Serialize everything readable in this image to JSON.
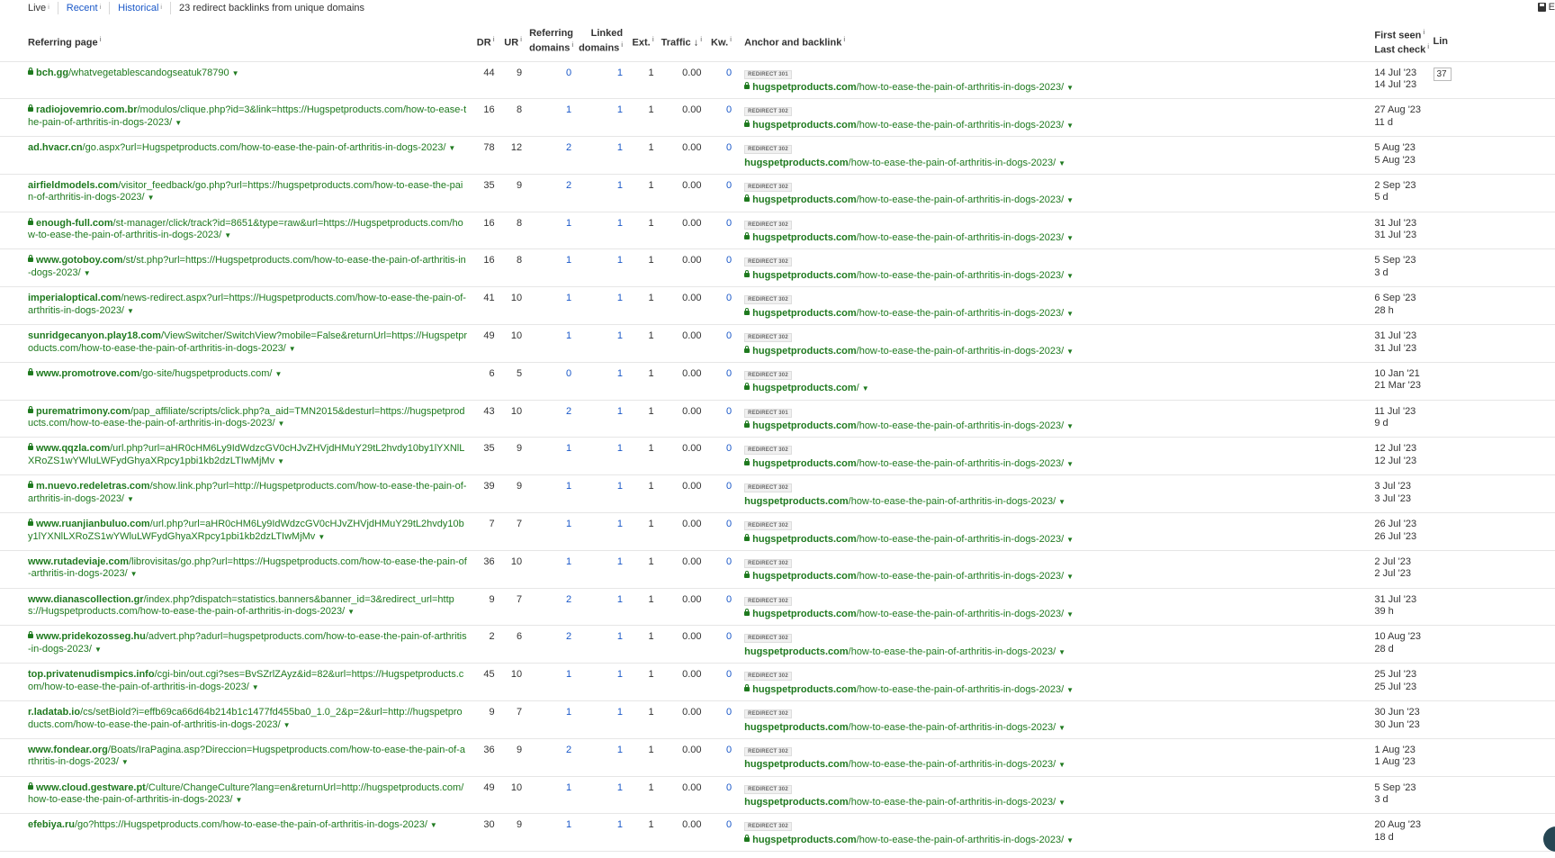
{
  "topbar": {
    "tabs": [
      "Live",
      "Recent",
      "Historical"
    ],
    "summary": "23 redirect backlinks from unique domains",
    "export_label": "E"
  },
  "columns": {
    "referring_page": "Referring page",
    "dr": "DR",
    "ur": "UR",
    "referring_domains_1": "Referring",
    "referring_domains_2": "domains",
    "linked_domains_1": "Linked",
    "linked_domains_2": "domains",
    "ext": "Ext.",
    "traffic": "Traffic",
    "traffic_sort": "↓",
    "kw": "Kw.",
    "anchor": "Anchor and backlink",
    "first_seen": "First seen",
    "last_check": "Last check",
    "lin": "Lin"
  },
  "rows": [
    {
      "secure": true,
      "domain": "bch.gg",
      "path": "/whatvegetablescandogseatuk78790",
      "dr": "44",
      "ur": "9",
      "rd": "0",
      "ld": "1",
      "ext": "1",
      "traffic": "0.00",
      "kw": "0",
      "redirect": "REDIRECT 301",
      "target_secure": true,
      "target_domain": "hugspetproducts.com",
      "target_path": "/how-to-ease-the-pain-of-arthritis-in-dogs-2023/",
      "first_seen": "14 Jul '23",
      "last_check": "14 Jul '23",
      "lin": "37"
    },
    {
      "secure": true,
      "domain": "radiojovemrio.com.br",
      "path": "/modulos/clique.php?id=3&link=https://Hugspetproducts.com/how-to-ease-the-pain-of-arthritis-in-dogs-2023/",
      "dr": "16",
      "ur": "8",
      "rd": "1",
      "ld": "1",
      "ext": "1",
      "traffic": "0.00",
      "kw": "0",
      "redirect": "REDIRECT 302",
      "target_secure": true,
      "target_domain": "hugspetproducts.com",
      "target_path": "/how-to-ease-the-pain-of-arthritis-in-dogs-2023/",
      "first_seen": "27 Aug '23",
      "last_check": "11 d"
    },
    {
      "secure": false,
      "domain": "ad.hvacr.cn",
      "path": "/go.aspx?url=Hugspetproducts.com/how-to-ease-the-pain-of-arthritis-in-dogs-2023/",
      "dr": "78",
      "ur": "12",
      "rd": "2",
      "ld": "1",
      "ext": "1",
      "traffic": "0.00",
      "kw": "0",
      "redirect": "REDIRECT 302",
      "target_secure": false,
      "target_domain": "hugspetproducts.com",
      "target_path": "/how-to-ease-the-pain-of-arthritis-in-dogs-2023/",
      "first_seen": "5 Aug '23",
      "last_check": "5 Aug '23"
    },
    {
      "secure": false,
      "domain": "airfieldmodels.com",
      "path": "/visitor_feedback/go.php?url=https://hugspetproducts.com/how-to-ease-the-pain-of-arthritis-in-dogs-2023/",
      "dr": "35",
      "ur": "9",
      "rd": "2",
      "ld": "1",
      "ext": "1",
      "traffic": "0.00",
      "kw": "0",
      "redirect": "REDIRECT 302",
      "target_secure": true,
      "target_domain": "hugspetproducts.com",
      "target_path": "/how-to-ease-the-pain-of-arthritis-in-dogs-2023/",
      "first_seen": "2 Sep '23",
      "last_check": "5 d"
    },
    {
      "secure": true,
      "domain": "enough-full.com",
      "path": "/st-manager/click/track?id=8651&type=raw&url=https://Hugspetproducts.com/how-to-ease-the-pain-of-arthritis-in-dogs-2023/",
      "dr": "16",
      "ur": "8",
      "rd": "1",
      "ld": "1",
      "ext": "1",
      "traffic": "0.00",
      "kw": "0",
      "redirect": "REDIRECT 302",
      "target_secure": true,
      "target_domain": "hugspetproducts.com",
      "target_path": "/how-to-ease-the-pain-of-arthritis-in-dogs-2023/",
      "first_seen": "31 Jul '23",
      "last_check": "31 Jul '23"
    },
    {
      "secure": true,
      "domain": "www.gotoboy.com",
      "path": "/st/st.php?url=https://Hugspetproducts.com/how-to-ease-the-pain-of-arthritis-in-dogs-2023/",
      "dr": "16",
      "ur": "8",
      "rd": "1",
      "ld": "1",
      "ext": "1",
      "traffic": "0.00",
      "kw": "0",
      "redirect": "REDIRECT 302",
      "target_secure": true,
      "target_domain": "hugspetproducts.com",
      "target_path": "/how-to-ease-the-pain-of-arthritis-in-dogs-2023/",
      "first_seen": "5 Sep '23",
      "last_check": "3 d"
    },
    {
      "secure": false,
      "domain": "imperialoptical.com",
      "path": "/news-redirect.aspx?url=https://Hugspetproducts.com/how-to-ease-the-pain-of-arthritis-in-dogs-2023/",
      "dr": "41",
      "ur": "10",
      "rd": "1",
      "ld": "1",
      "ext": "1",
      "traffic": "0.00",
      "kw": "0",
      "redirect": "REDIRECT 302",
      "target_secure": true,
      "target_domain": "hugspetproducts.com",
      "target_path": "/how-to-ease-the-pain-of-arthritis-in-dogs-2023/",
      "first_seen": "6 Sep '23",
      "last_check": "28 h"
    },
    {
      "secure": false,
      "domain": "sunridgecanyon.play18.com",
      "path": "/ViewSwitcher/SwitchView?mobile=False&returnUrl=https://Hugspetproducts.com/how-to-ease-the-pain-of-arthritis-in-dogs-2023/",
      "dr": "49",
      "ur": "10",
      "rd": "1",
      "ld": "1",
      "ext": "1",
      "traffic": "0.00",
      "kw": "0",
      "redirect": "REDIRECT 302",
      "target_secure": true,
      "target_domain": "hugspetproducts.com",
      "target_path": "/how-to-ease-the-pain-of-arthritis-in-dogs-2023/",
      "first_seen": "31 Jul '23",
      "last_check": "31 Jul '23"
    },
    {
      "secure": true,
      "domain": "www.promotrove.com",
      "path": "/go-site/hugspetproducts.com/",
      "dr": "6",
      "ur": "5",
      "rd": "0",
      "ld": "1",
      "ext": "1",
      "traffic": "0.00",
      "kw": "0",
      "redirect": "REDIRECT 302",
      "target_secure": true,
      "target_domain": "hugspetproducts.com",
      "target_path": "/",
      "first_seen": "10 Jan '21",
      "last_check": "21 Mar '23"
    },
    {
      "secure": true,
      "domain": "purematrimony.com",
      "path": "/pap_affiliate/scripts/click.php?a_aid=TMN2015&desturl=https://hugspetproducts.com/how-to-ease-the-pain-of-arthritis-in-dogs-2023/",
      "dr": "43",
      "ur": "10",
      "rd": "2",
      "ld": "1",
      "ext": "1",
      "traffic": "0.00",
      "kw": "0",
      "redirect": "REDIRECT 301",
      "target_secure": true,
      "target_domain": "hugspetproducts.com",
      "target_path": "/how-to-ease-the-pain-of-arthritis-in-dogs-2023/",
      "first_seen": "11 Jul '23",
      "last_check": "9 d"
    },
    {
      "secure": true,
      "domain": "www.qqzla.com",
      "path": "/url.php?url=aHR0cHM6Ly9IdWdzcGV0cHJvZHVjdHMuY29tL2hvdy10by1lYXNlLXRoZS1wYWluLWFydGhyaXRpcy1pbi1kb2dzLTIwMjMv",
      "dr": "35",
      "ur": "9",
      "rd": "1",
      "ld": "1",
      "ext": "1",
      "traffic": "0.00",
      "kw": "0",
      "redirect": "REDIRECT 302",
      "target_secure": true,
      "target_domain": "hugspetproducts.com",
      "target_path": "/how-to-ease-the-pain-of-arthritis-in-dogs-2023/",
      "first_seen": "12 Jul '23",
      "last_check": "12 Jul '23"
    },
    {
      "secure": true,
      "domain": "m.nuevo.redeletras.com",
      "path": "/show.link.php?url=http://Hugspetproducts.com/how-to-ease-the-pain-of-arthritis-in-dogs-2023/",
      "dr": "39",
      "ur": "9",
      "rd": "1",
      "ld": "1",
      "ext": "1",
      "traffic": "0.00",
      "kw": "0",
      "redirect": "REDIRECT 302",
      "target_secure": false,
      "target_domain": "hugspetproducts.com",
      "target_path": "/how-to-ease-the-pain-of-arthritis-in-dogs-2023/",
      "first_seen": "3 Jul '23",
      "last_check": "3 Jul '23"
    },
    {
      "secure": true,
      "domain": "www.ruanjianbuluo.com",
      "path": "/url.php?url=aHR0cHM6Ly9IdWdzcGV0cHJvZHVjdHMuY29tL2hvdy10by1lYXNlLXRoZS1wYWluLWFydGhyaXRpcy1pbi1kb2dzLTIwMjMv",
      "dr": "7",
      "ur": "7",
      "rd": "1",
      "ld": "1",
      "ext": "1",
      "traffic": "0.00",
      "kw": "0",
      "redirect": "REDIRECT 302",
      "target_secure": true,
      "target_domain": "hugspetproducts.com",
      "target_path": "/how-to-ease-the-pain-of-arthritis-in-dogs-2023/",
      "first_seen": "26 Jul '23",
      "last_check": "26 Jul '23"
    },
    {
      "secure": false,
      "domain": "www.rutadeviaje.com",
      "path": "/librovisitas/go.php?url=https://Hugspetproducts.com/how-to-ease-the-pain-of-arthritis-in-dogs-2023/",
      "dr": "36",
      "ur": "10",
      "rd": "1",
      "ld": "1",
      "ext": "1",
      "traffic": "0.00",
      "kw": "0",
      "redirect": "REDIRECT 302",
      "target_secure": true,
      "target_domain": "hugspetproducts.com",
      "target_path": "/how-to-ease-the-pain-of-arthritis-in-dogs-2023/",
      "first_seen": "2 Jul '23",
      "last_check": "2 Jul '23"
    },
    {
      "secure": false,
      "domain": "www.dianascollection.gr",
      "path": "/index.php?dispatch=statistics.banners&banner_id=3&redirect_url=https://Hugspetproducts.com/how-to-ease-the-pain-of-arthritis-in-dogs-2023/",
      "dr": "9",
      "ur": "7",
      "rd": "2",
      "ld": "1",
      "ext": "1",
      "traffic": "0.00",
      "kw": "0",
      "redirect": "REDIRECT 302",
      "target_secure": true,
      "target_domain": "hugspetproducts.com",
      "target_path": "/how-to-ease-the-pain-of-arthritis-in-dogs-2023/",
      "first_seen": "31 Jul '23",
      "last_check": "39 h"
    },
    {
      "secure": true,
      "domain": "www.pridekozosseg.hu",
      "path": "/advert.php?adurl=hugspetproducts.com/how-to-ease-the-pain-of-arthritis-in-dogs-2023/",
      "dr": "2",
      "ur": "6",
      "rd": "2",
      "ld": "1",
      "ext": "1",
      "traffic": "0.00",
      "kw": "0",
      "redirect": "REDIRECT 302",
      "target_secure": false,
      "target_domain": "hugspetproducts.com",
      "target_path": "/how-to-ease-the-pain-of-arthritis-in-dogs-2023/",
      "first_seen": "10 Aug '23",
      "last_check": "28 d"
    },
    {
      "secure": false,
      "domain": "top.privatenudismpics.info",
      "path": "/cgi-bin/out.cgi?ses=BvSZrlZAyz&id=82&url=https://Hugspetproducts.com/how-to-ease-the-pain-of-arthritis-in-dogs-2023/",
      "dr": "45",
      "ur": "10",
      "rd": "1",
      "ld": "1",
      "ext": "1",
      "traffic": "0.00",
      "kw": "0",
      "redirect": "REDIRECT 302",
      "target_secure": true,
      "target_domain": "hugspetproducts.com",
      "target_path": "/how-to-ease-the-pain-of-arthritis-in-dogs-2023/",
      "first_seen": "25 Jul '23",
      "last_check": "25 Jul '23"
    },
    {
      "secure": false,
      "domain": "r.ladatab.io",
      "path": "/cs/setBiold?i=effb69ca66d64b214b1c1477fd455ba0_1.0_2&p=2&url=http://hugspetproducts.com/how-to-ease-the-pain-of-arthritis-in-dogs-2023/",
      "dr": "9",
      "ur": "7",
      "rd": "1",
      "ld": "1",
      "ext": "1",
      "traffic": "0.00",
      "kw": "0",
      "redirect": "REDIRECT 302",
      "target_secure": false,
      "target_domain": "hugspetproducts.com",
      "target_path": "/how-to-ease-the-pain-of-arthritis-in-dogs-2023/",
      "first_seen": "30 Jun '23",
      "last_check": "30 Jun '23"
    },
    {
      "secure": false,
      "domain": "www.fondear.org",
      "path": "/Boats/IraPagina.asp?Direccion=Hugspetproducts.com/how-to-ease-the-pain-of-arthritis-in-dogs-2023/",
      "dr": "36",
      "ur": "9",
      "rd": "2",
      "ld": "1",
      "ext": "1",
      "traffic": "0.00",
      "kw": "0",
      "redirect": "REDIRECT 302",
      "target_secure": false,
      "target_domain": "hugspetproducts.com",
      "target_path": "/how-to-ease-the-pain-of-arthritis-in-dogs-2023/",
      "first_seen": "1 Aug '23",
      "last_check": "1 Aug '23"
    },
    {
      "secure": true,
      "domain": "www.cloud.gestware.pt",
      "path": "/Culture/ChangeCulture?lang=en&returnUrl=http://hugspetproducts.com/how-to-ease-the-pain-of-arthritis-in-dogs-2023/",
      "dr": "49",
      "ur": "10",
      "rd": "1",
      "ld": "1",
      "ext": "1",
      "traffic": "0.00",
      "kw": "0",
      "redirect": "REDIRECT 302",
      "target_secure": false,
      "target_domain": "hugspetproducts.com",
      "target_path": "/how-to-ease-the-pain-of-arthritis-in-dogs-2023/",
      "first_seen": "5 Sep '23",
      "last_check": "3 d"
    },
    {
      "secure": false,
      "domain": "efebiya.ru",
      "path": "/go?https://Hugspetproducts.com/how-to-ease-the-pain-of-arthritis-in-dogs-2023/",
      "dr": "30",
      "ur": "9",
      "rd": "1",
      "ld": "1",
      "ext": "1",
      "traffic": "0.00",
      "kw": "0",
      "redirect": "REDIRECT 302",
      "target_secure": true,
      "target_domain": "hugspetproducts.com",
      "target_path": "/how-to-ease-the-pain-of-arthritis-in-dogs-2023/",
      "first_seen": "20 Aug '23",
      "last_check": "18 d"
    }
  ]
}
